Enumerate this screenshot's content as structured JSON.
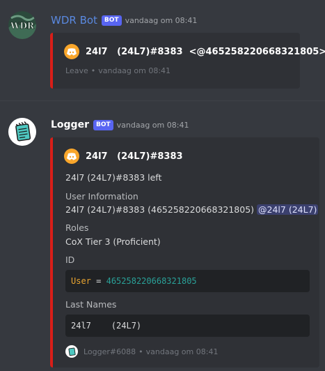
{
  "messages": [
    {
      "author": "WDR Bot",
      "author_color": "#5a89e0",
      "bot_tag": "BOT",
      "timestamp": "vandaag om 08:41",
      "avatar_text": "WDR",
      "embed": {
        "color": "#d91e18",
        "author_name": "24l7   (24L7)#8383  <@465258220668321805>",
        "footer_text": "Leave",
        "footer_sep": "•",
        "footer_timestamp": "vandaag om 08:41"
      }
    },
    {
      "author": "Logger",
      "author_color": "#ffffff",
      "bot_tag": "BOT",
      "timestamp": "vandaag om 08:41",
      "embed": {
        "color": "#d91e18",
        "author_name": "24l7   (24L7)#8383",
        "description": "24l7 (24L7)#8383 left",
        "fields": [
          {
            "name": "User Information",
            "value": "24l7 (24L7)#8383 (465258220668321805)",
            "mention": "@24l7 (24L7)"
          },
          {
            "name": "Roles",
            "value": "CoX Tier 3 (Proficient)"
          },
          {
            "name": "ID",
            "code": {
              "key": "User",
              "op": "=",
              "val": "465258220668321805"
            }
          },
          {
            "name": "Last Names",
            "code_plain": "24l7    (24L7)"
          }
        ],
        "footer_text": "Logger#6088",
        "footer_sep": "•",
        "footer_timestamp": "vandaag om 08:41"
      }
    }
  ]
}
